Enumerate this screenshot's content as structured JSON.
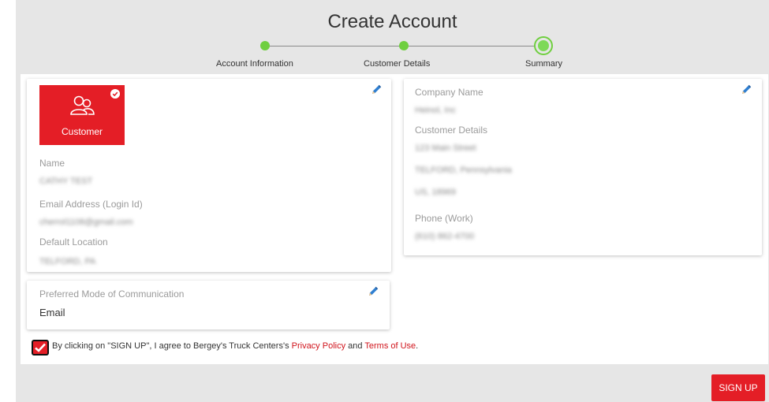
{
  "title": "Create Account",
  "steps": [
    {
      "label": "Account Information",
      "state": "done"
    },
    {
      "label": "Customer Details",
      "state": "done"
    },
    {
      "label": "Summary",
      "state": "current"
    }
  ],
  "account_card": {
    "role_label": "Customer",
    "name_label": "Name",
    "name_value": "CATHY TEST",
    "email_label": "Email Address (Login Id)",
    "email_value": "cherrol1108@gmail.com",
    "location_label": "Default Location",
    "location_value": "TELFORD, PA"
  },
  "communication_card": {
    "label": "Preferred Mode of Communication",
    "value": "Email"
  },
  "company_card": {
    "company_label": "Company Name",
    "company_value": "Heinol, Inc",
    "details_label": "Customer Details",
    "address_line1": "123 Main Street",
    "address_line2": "TELFORD, Pennsylvania",
    "address_line3": "US, 18969",
    "phone_label": "Phone (Work)",
    "phone_value": "(610) 862-4700"
  },
  "consent": {
    "prefix": "By clicking on \"SIGN UP\", I agree to Bergey's Truck Centers's ",
    "privacy_link": "Privacy Policy",
    "middle": " and ",
    "terms_link": "Terms of Use",
    "suffix": ".",
    "checked": true
  },
  "signup_button": "SIGN UP",
  "colors": {
    "accent": "#e41e26",
    "step_green": "#6fcf3f",
    "background": "#e6e6e6"
  },
  "icons": [
    "people-icon",
    "check-circle-icon",
    "pencil-icon",
    "checkmark-icon"
  ]
}
